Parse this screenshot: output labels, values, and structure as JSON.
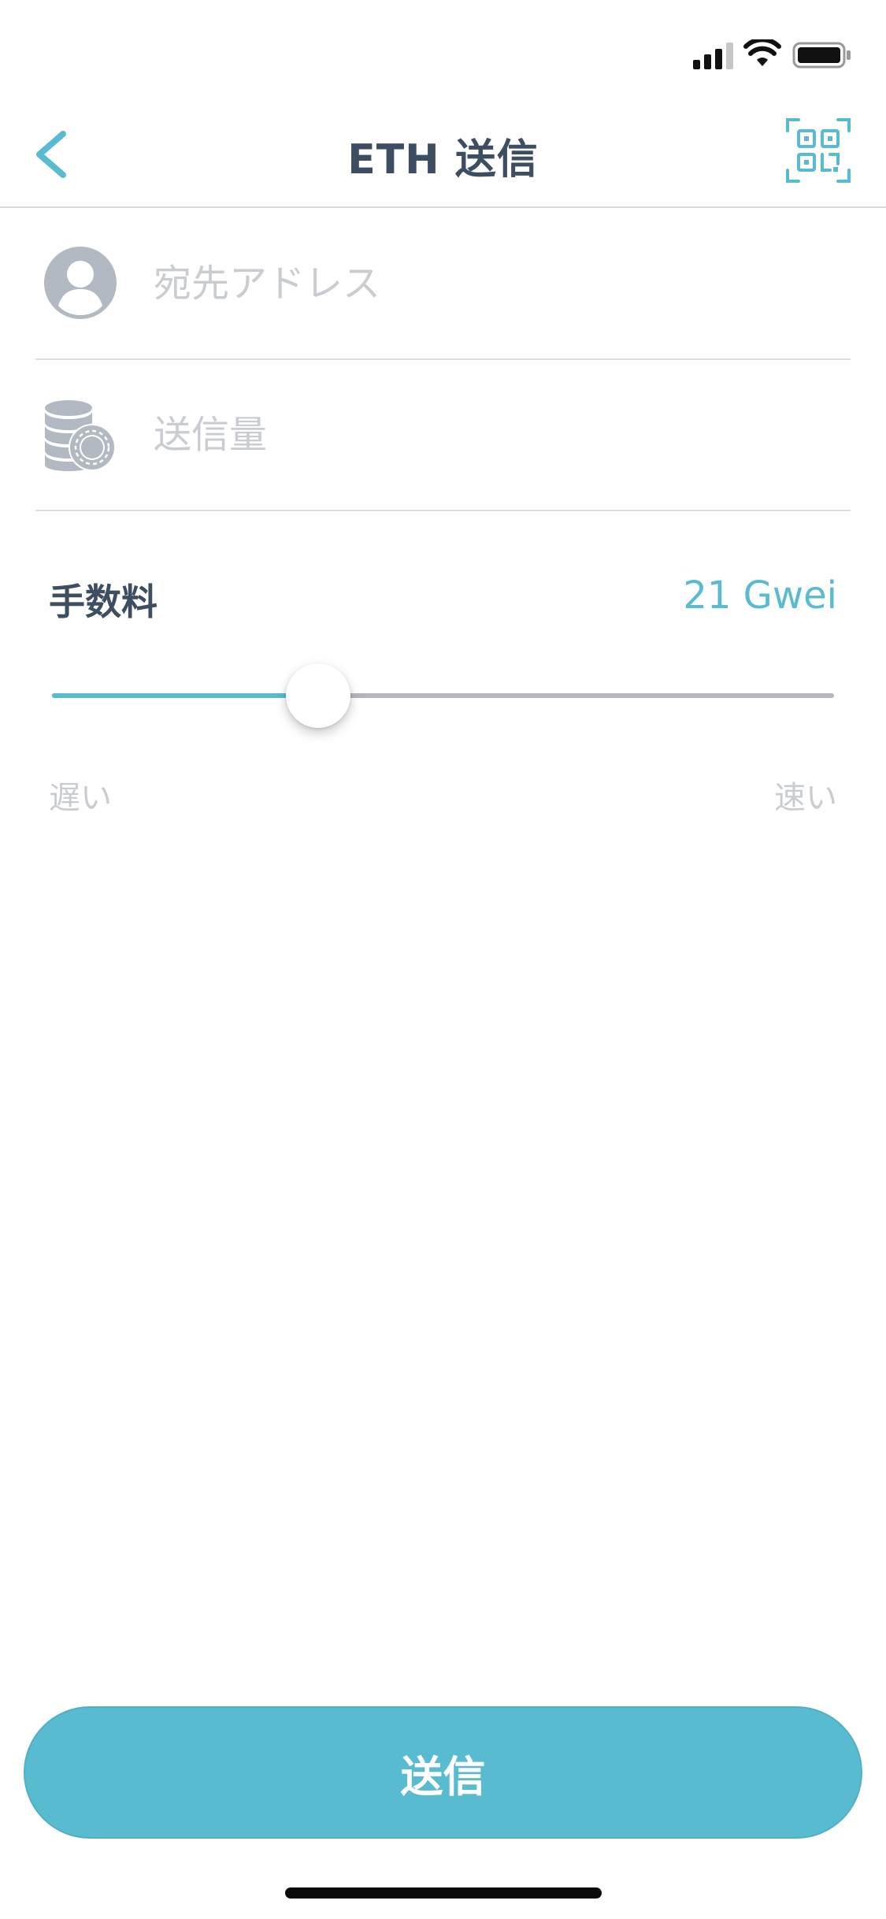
{
  "status_bar": {
    "icons": [
      "signal-icon",
      "wifi-icon",
      "battery-icon"
    ]
  },
  "nav": {
    "back_icon": "chevron-left-icon",
    "title": "ETH 送信",
    "qr_icon": "qr-code-icon"
  },
  "form": {
    "address": {
      "icon": "person-icon",
      "placeholder": "宛先アドレス",
      "value": ""
    },
    "amount": {
      "icon": "coins-icon",
      "placeholder": "送信量",
      "value": ""
    }
  },
  "fee": {
    "label": "手数料",
    "value": "21 Gwei",
    "slider_fraction": 0.34,
    "slow_label": "遅い",
    "fast_label": "速い"
  },
  "send_button": {
    "label": "送信"
  },
  "colors": {
    "accent": "#59bbcf",
    "title_text": "#3e4e62",
    "placeholder_text": "#c9ccd1",
    "divider": "#dcdfe2",
    "icon_gray": "#b2b9c3"
  }
}
